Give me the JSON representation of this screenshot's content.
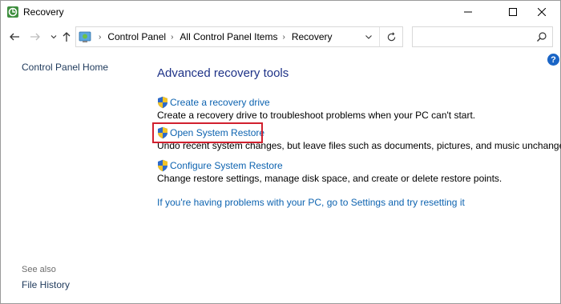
{
  "window": {
    "title": "Recovery"
  },
  "address": {
    "crumbs": [
      "Control Panel",
      "All Control Panel Items",
      "Recovery"
    ]
  },
  "search": {
    "placeholder": ""
  },
  "left_pane": {
    "home_link": "Control Panel Home",
    "see_also_label": "See also",
    "file_history_link": "File History"
  },
  "main": {
    "heading": "Advanced recovery tools",
    "tools": [
      {
        "link": "Create a recovery drive",
        "description": "Create a recovery drive to troubleshoot problems when your PC can't start."
      },
      {
        "link": "Open System Restore",
        "description": "Undo recent system changes, but leave files such as documents, pictures, and music unchanged."
      },
      {
        "link": "Configure System Restore",
        "description": "Change restore settings, manage disk space, and create or delete restore points."
      }
    ],
    "reset_link": "If you're having problems with your PC, go to Settings and try resetting it"
  },
  "colors": {
    "link": "#0d63b0",
    "heading": "#1e3287",
    "highlight": "#d1202e",
    "help_badge": "#1a65c6"
  },
  "icons": {
    "app": "control-panel-recovery-icon",
    "shield": "uac-shield-icon",
    "help": "help-icon"
  }
}
